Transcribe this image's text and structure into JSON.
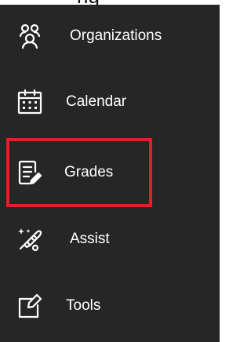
{
  "header": {
    "cropped_text": "ng"
  },
  "nav": {
    "items": [
      {
        "label": "Organizations",
        "icon": "organizations-icon"
      },
      {
        "label": "Calendar",
        "icon": "calendar-icon"
      },
      {
        "label": "Grades",
        "icon": "grades-icon"
      },
      {
        "label": "Assist",
        "icon": "assist-icon"
      },
      {
        "label": "Tools",
        "icon": "tools-icon"
      }
    ],
    "highlighted_item": "Grades"
  },
  "colors": {
    "background": "#262626",
    "text": "#ffffff",
    "highlight_border": "#e01f26"
  }
}
